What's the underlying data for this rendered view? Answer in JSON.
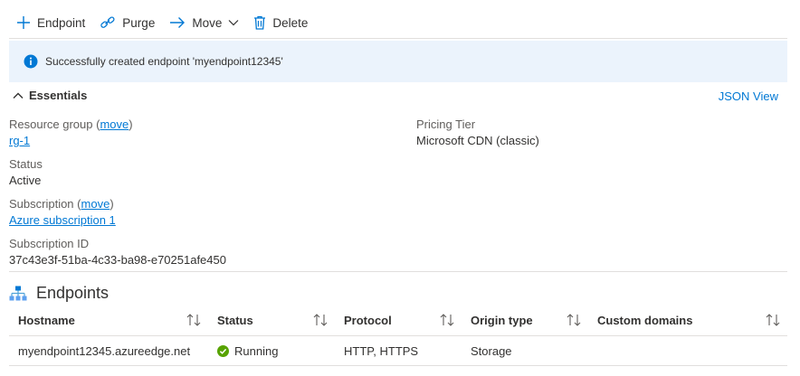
{
  "toolbar": {
    "endpoint_label": "Endpoint",
    "purge_label": "Purge",
    "move_label": "Move",
    "delete_label": "Delete"
  },
  "banner": {
    "message": "Successfully created endpoint 'myendpoint12345'"
  },
  "essentials": {
    "title": "Essentials",
    "json_view": "JSON View",
    "resource_group_label": "Resource group",
    "move_paren_open": "(",
    "move_link": "move",
    "move_paren_close": ")",
    "resource_group_value": "rg-1",
    "status_label": "Status",
    "status_value": "Active",
    "subscription_label": "Subscription",
    "subscription_value": "Azure subscription 1",
    "subscription_id_label": "Subscription ID",
    "subscription_id_value": "37c43e3f-51ba-4c33-ba98-e70251afe450",
    "pricing_tier_label": "Pricing Tier",
    "pricing_tier_value": "Microsoft CDN (classic)"
  },
  "endpoints": {
    "title": "Endpoints",
    "columns": [
      "Hostname",
      "Status",
      "Protocol",
      "Origin type",
      "Custom domains"
    ],
    "rows": [
      {
        "hostname": "myendpoint12345.azureedge.net",
        "status": "Running",
        "protocol": "HTTP, HTTPS",
        "origin_type": "Storage",
        "custom_domains": ""
      }
    ]
  },
  "colors": {
    "accent": "#0078d4",
    "banner_bg": "#ebf3fc",
    "running_green": "#57a300"
  },
  "icons": {
    "endpoint": "plus-icon",
    "purge": "link-icon",
    "move": "arrow-right-icon",
    "delete": "trash-icon",
    "info": "info-icon",
    "essentials": "chevron-up-icon",
    "endpoints": "hierarchy-icon",
    "running": "check-circle-icon"
  }
}
